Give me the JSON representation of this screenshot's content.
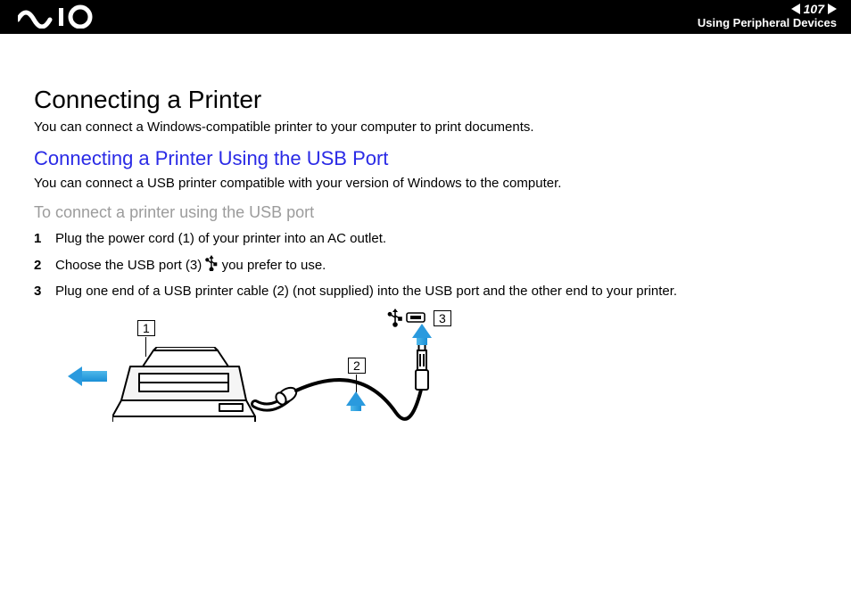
{
  "header": {
    "page_number": "107",
    "section": "Using Peripheral Devices"
  },
  "h1": "Connecting a Printer",
  "intro": "You can connect a Windows-compatible printer to your computer to print documents.",
  "h2": "Connecting a Printer Using the USB Port",
  "sub": "You can connect a USB printer compatible with your version of Windows to the computer.",
  "h3": "To connect a printer using the USB port",
  "steps": [
    {
      "n": "1",
      "text": "Plug the power cord (1) of your printer into an AC outlet."
    },
    {
      "n": "2",
      "text_before": "Choose the USB port (3) ",
      "text_after": " you prefer to use."
    },
    {
      "n": "3",
      "text": "Plug one end of a USB printer cable (2) (not supplied) into the USB port and the other end to your printer."
    }
  ],
  "diagram": {
    "label1": "1",
    "label2": "2",
    "label3": "3"
  }
}
